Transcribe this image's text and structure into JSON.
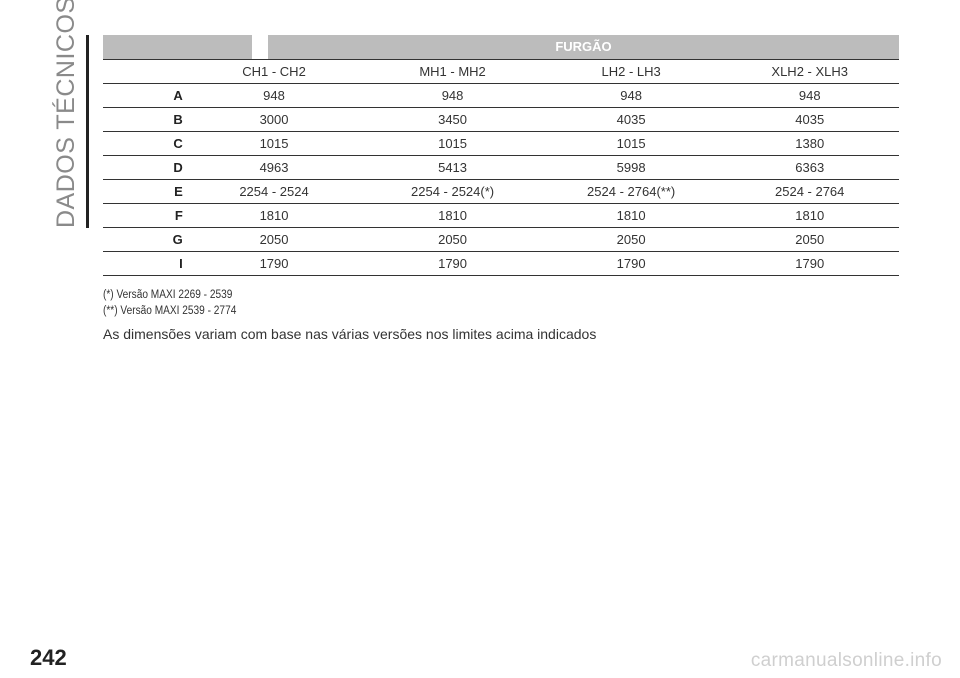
{
  "section_title": "DADOS TÉCNICOS",
  "table": {
    "header": "FURGÃO",
    "columns": [
      "CH1 - CH2",
      "MH1 - MH2",
      "LH2 - LH3",
      "XLH2 - XLH3"
    ],
    "rows": [
      {
        "label": "A",
        "values": [
          "948",
          "948",
          "948",
          "948"
        ]
      },
      {
        "label": "B",
        "values": [
          "3000",
          "3450",
          "4035",
          "4035"
        ]
      },
      {
        "label": "C",
        "values": [
          "1015",
          "1015",
          "1015",
          "1380"
        ]
      },
      {
        "label": "D",
        "values": [
          "4963",
          "5413",
          "5998",
          "6363"
        ]
      },
      {
        "label": "E",
        "values": [
          "2254 - 2524",
          "2254 - 2524",
          "2524 - 2764",
          "2524 - 2764"
        ],
        "marks": [
          "",
          "(*)",
          "(**)",
          ""
        ]
      },
      {
        "label": "F",
        "values": [
          "1810",
          "1810",
          "1810",
          "1810"
        ]
      },
      {
        "label": "G",
        "values": [
          "2050",
          "2050",
          "2050",
          "2050"
        ]
      },
      {
        "label": "I",
        "values": [
          "1790",
          "1790",
          "1790",
          "1790"
        ]
      }
    ]
  },
  "notes": [
    "(*) Versão MAXI 2269 - 2539",
    "(**) Versão MAXI 2539 - 2774"
  ],
  "summary": "As dimensões variam com base nas várias versões nos limites acima indicados",
  "page_number": "242",
  "watermark": "carmanualsonline.info"
}
